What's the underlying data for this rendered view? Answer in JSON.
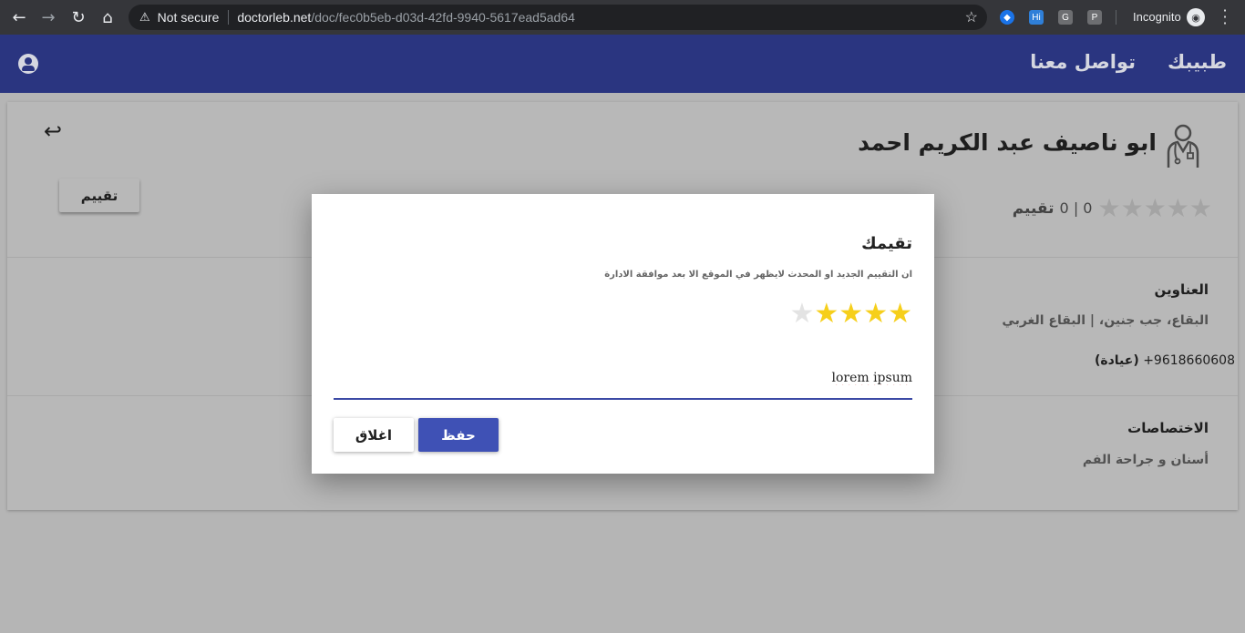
{
  "browser": {
    "security_label": "Not secure",
    "url_host": "doctorleb.net",
    "url_path": "/doc/fec0b5eb-d03d-42fd-9940-5617ead5ad64",
    "incognito_label": "Incognito",
    "extensions": [
      "Hi",
      "G",
      "P"
    ]
  },
  "appbar": {
    "brand": "طبيبك",
    "contact": "تواصل معنا",
    "color": "#2a3580"
  },
  "doctor": {
    "name": "ابو ناصيف عبد الكريم احمد",
    "rating_value": 0,
    "rating_stars": "★★★★★",
    "rating_count_text": "0 | 0",
    "rating_label": "تقييم",
    "rate_button": "تقييم"
  },
  "addresses": {
    "title": "العناوين",
    "text": "البقاع، جب جنين، | البقاع الغربي",
    "phone": "+9618660608",
    "phone_type": "(عيادة)"
  },
  "specialties": {
    "title": "الاختصاصات",
    "text": "أسنان و جراحة الفم"
  },
  "dialog": {
    "title": "تقيمك",
    "note": "ان التقييم الجديد او المحدث لايظهر في الموقع الا بعد موافقة الادارة",
    "stars_selected": 4,
    "stars_total": 5,
    "review_text": "lorem ipsum",
    "close_label": "اغلاق",
    "save_label": "حفظ",
    "accent": "#3f51b5",
    "star_color": "#f6cf1b"
  }
}
